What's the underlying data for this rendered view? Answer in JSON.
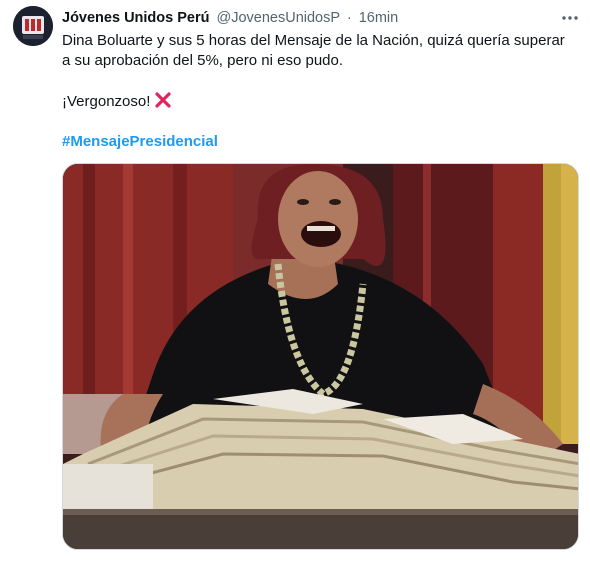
{
  "tweet": {
    "author_name": "Jóvenes Unidos Perú",
    "author_handle": "@JovenesUnidosP",
    "separator": "·",
    "timestamp": "16min",
    "more_icon": "more-horizontal-icon",
    "text_line_1": "Dina Boluarte y sus 5 horas del Mensaje de la Nación, quizá quería superar",
    "text_line_2": "a su aprobación del 5%, pero ni eso pudo.",
    "text_line_3": "¡Vergonzoso!",
    "emoji": "cross-mark-icon",
    "hashtag": "#MensajePresidencial"
  },
  "colors": {
    "text": "#0f1419",
    "secondary": "#536471",
    "link": "#1d9bf0",
    "emoji_red": "#e0245e",
    "border": "#cfd9de"
  }
}
